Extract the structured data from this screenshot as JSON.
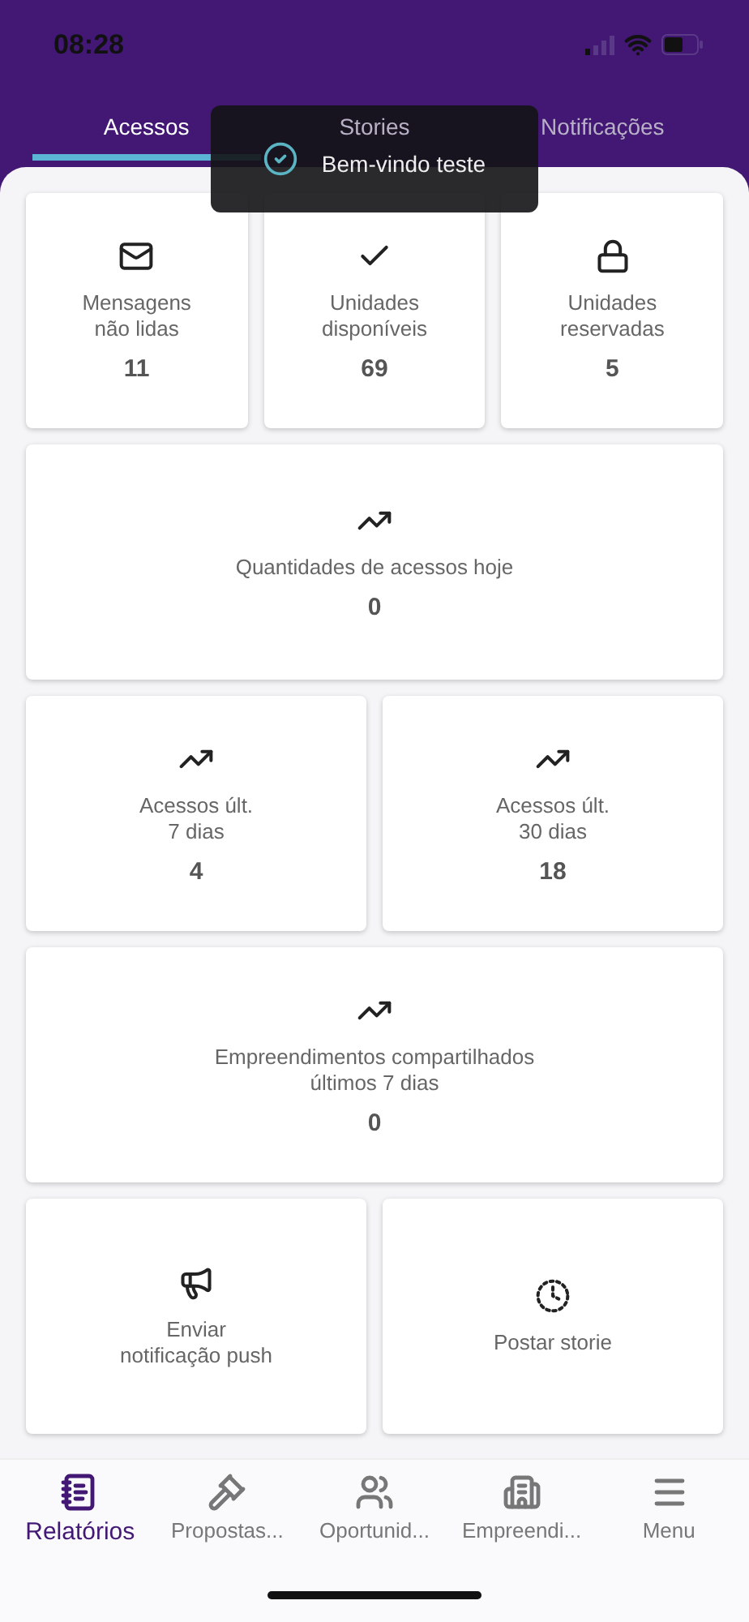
{
  "status_bar": {
    "time": "08:28"
  },
  "tabs": [
    {
      "label": "Acessos",
      "selected": true
    },
    {
      "label": "Stories",
      "selected": false
    },
    {
      "label": "Notificações",
      "selected": false
    }
  ],
  "toast": {
    "message": "Bem-vindo teste"
  },
  "rows": [
    {
      "cards": [
        {
          "kind": "stat",
          "label": "Mensagens\nnão lidas",
          "value": "11"
        },
        {
          "kind": "stat",
          "label": "Unidades\ndisponíveis",
          "value": "69"
        },
        {
          "kind": "stat",
          "label": "Unidades\nreservadas",
          "value": "5"
        }
      ]
    },
    {
      "cards": [
        {
          "kind": "stat",
          "label": "Quantidades de acessos hoje",
          "value": "0"
        }
      ]
    },
    {
      "cards": [
        {
          "kind": "stat",
          "label": "Acessos últ.\n7 dias",
          "value": "4"
        },
        {
          "kind": "stat",
          "label": "Acessos últ.\n30 dias",
          "value": "18"
        }
      ]
    },
    {
      "cards": [
        {
          "kind": "stat",
          "label": "Empreendimentos compartilhados\núltimos 7 dias",
          "value": "0"
        }
      ]
    },
    {
      "cards": [
        {
          "kind": "action",
          "label": "Enviar\nnotificação  push"
        },
        {
          "kind": "action",
          "label": "Postar storie"
        }
      ]
    }
  ],
  "bottom_nav": [
    {
      "label": "Relatórios",
      "selected": true
    },
    {
      "label": "Propostas...",
      "selected": false
    },
    {
      "label": "Oportunid...",
      "selected": false
    },
    {
      "label": "Empreendi...",
      "selected": false
    },
    {
      "label": "Menu",
      "selected": false
    }
  ]
}
